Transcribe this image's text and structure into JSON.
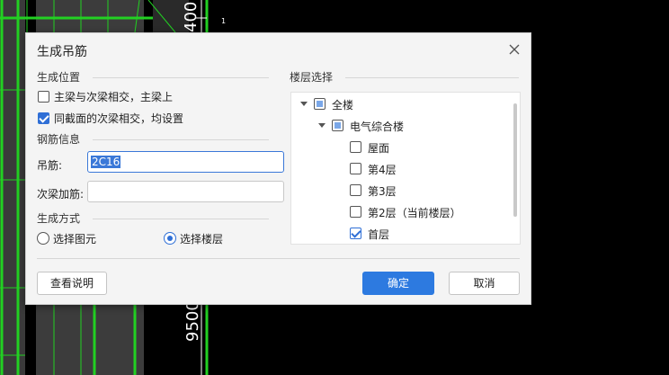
{
  "dialog": {
    "title": "生成吊筋",
    "close_icon": "close-icon"
  },
  "position": {
    "heading": "生成位置",
    "options": [
      {
        "label": "主梁与次梁相交，主梁上",
        "checked": false
      },
      {
        "label": "同截面的次梁相交，均设置",
        "checked": true
      }
    ]
  },
  "rebar": {
    "heading": "钢筋信息",
    "hanger_label": "吊筋:",
    "hanger_value": "2C16",
    "secondary_label": "次梁加筋:",
    "secondary_value": ""
  },
  "method": {
    "heading": "生成方式",
    "options": [
      {
        "label": "选择图元",
        "selected": false
      },
      {
        "label": "选择楼层",
        "selected": true
      }
    ]
  },
  "floors": {
    "heading": "楼层选择",
    "items": [
      {
        "label": "全楼",
        "level": 0,
        "state": "partial",
        "expanded": true
      },
      {
        "label": "电气综合楼",
        "level": 1,
        "state": "partial",
        "expanded": true
      },
      {
        "label": "屋面",
        "level": 2,
        "state": "unchecked"
      },
      {
        "label": "第4层",
        "level": 2,
        "state": "unchecked"
      },
      {
        "label": "第3层",
        "level": 2,
        "state": "unchecked"
      },
      {
        "label": "第2层（当前楼层）",
        "level": 2,
        "state": "unchecked"
      },
      {
        "label": "首层",
        "level": 2,
        "state": "checked"
      }
    ]
  },
  "buttons": {
    "help": "查看说明",
    "ok": "确定",
    "cancel": "取消"
  },
  "background": {
    "dim_top": "400",
    "dim_bottom": "9500",
    "tick": "1"
  },
  "colors": {
    "accent": "#2d7ae0",
    "cad_green": "#22d022",
    "cad_bg": "#000000"
  }
}
